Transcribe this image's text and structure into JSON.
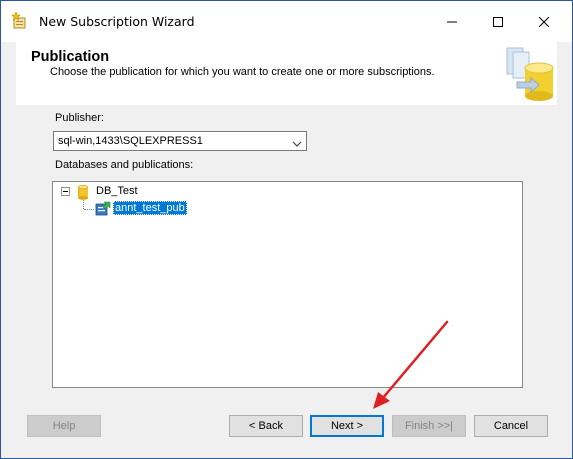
{
  "window": {
    "title": "New Subscription Wizard"
  },
  "header": {
    "title": "Publication",
    "subtitle": "Choose the publication for which you want to create one or more subscriptions."
  },
  "publisher": {
    "label": "Publisher:",
    "value": "sql-win,1433\\SQLEXPRESS1"
  },
  "tree": {
    "label": "Databases and publications:",
    "database": "DB_Test",
    "publication": "annt_test_pub"
  },
  "buttons": {
    "help": "Help",
    "back": "< Back",
    "next": "Next >",
    "finish": "Finish >>|",
    "cancel": "Cancel"
  },
  "colors": {
    "selection": "#0078d7",
    "annotation_arrow": "#e02020"
  },
  "icons": {
    "title": "wizard-star-icon",
    "database": "database-icon",
    "publication": "publication-icon",
    "header": "database-wizard-graphic-icon"
  }
}
